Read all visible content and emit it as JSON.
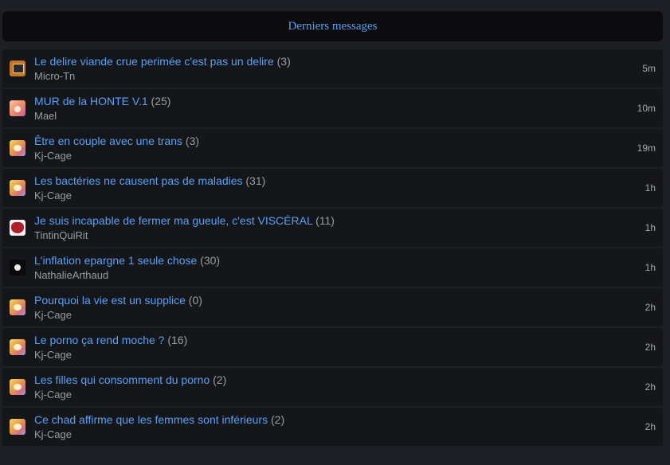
{
  "header": {
    "title": "Derniers messages"
  },
  "topics": [
    {
      "title": "Le delire viande crue perimée c'est pas un delire",
      "count": "(3)",
      "author": "Micro-Tn",
      "time": "5m",
      "avatar_icon": "device-avatar"
    },
    {
      "title": "MUR de la HONTE V.1",
      "count": "(25)",
      "author": "Mael",
      "time": "10m",
      "avatar_icon": "anime-avatar"
    },
    {
      "title": "Être en couple avec une trans",
      "count": "(3)",
      "author": "Kj-Cage",
      "time": "19m",
      "avatar_icon": "cartoon-avatar"
    },
    {
      "title": "Les bactéries ne causent pas de maladies",
      "count": "(31)",
      "author": "Kj-Cage",
      "time": "1h",
      "avatar_icon": "cartoon-avatar"
    },
    {
      "title": "Je suis incapable de fermer ma gueule, c'est VISCÉRAL",
      "count": "(11)",
      "author": "TintinQuiRit",
      "time": "1h",
      "avatar_icon": "red-avatar"
    },
    {
      "title": "L'inflation epargne 1 seule chose",
      "count": "(30)",
      "author": "NathalieArthaud",
      "time": "1h",
      "avatar_icon": "dark-avatar"
    },
    {
      "title": "Pourquoi la vie est un supplice",
      "count": "(0)",
      "author": "Kj-Cage",
      "time": "2h",
      "avatar_icon": "cartoon-avatar"
    },
    {
      "title": "Le porno ça rend moche ?",
      "count": "(16)",
      "author": "Kj-Cage",
      "time": "2h",
      "avatar_icon": "cartoon-avatar"
    },
    {
      "title": "Les filles qui consomment du porno",
      "count": "(2)",
      "author": "Kj-Cage",
      "time": "2h",
      "avatar_icon": "cartoon-avatar"
    },
    {
      "title": "Ce chad affirme que les femmes sont inférieurs",
      "count": "(2)",
      "author": "Kj-Cage",
      "time": "2h",
      "avatar_icon": "cartoon-avatar"
    }
  ],
  "colors": {
    "background": "#1e1f24",
    "row_background": "#15161a",
    "header_background": "#0c0c0e",
    "link": "#5aa0f5",
    "muted": "#9a9ca4"
  }
}
